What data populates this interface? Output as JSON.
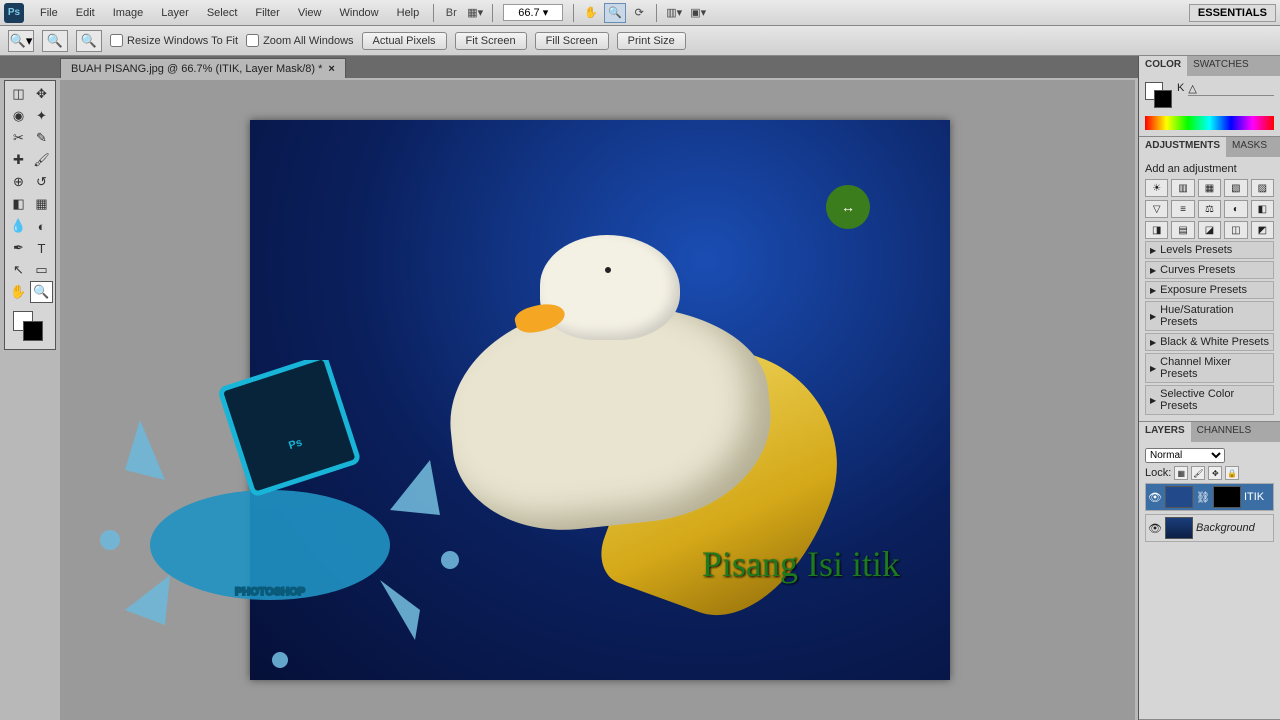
{
  "menu": {
    "items": [
      "File",
      "Edit",
      "Image",
      "Layer",
      "Select",
      "Filter",
      "View",
      "Window",
      "Help"
    ],
    "zoom": "66.7",
    "workspace": "ESSENTIALS"
  },
  "options": {
    "resize_windows": "Resize Windows To Fit",
    "zoom_all": "Zoom All Windows",
    "actual": "Actual Pixels",
    "fit": "Fit Screen",
    "fill": "Fill Screen",
    "print": "Print Size"
  },
  "tab": {
    "label": "BUAH PISANG.jpg @ 66.7% (ITIK, Layer Mask/8) *"
  },
  "canvas": {
    "text": "Pisang Isi itik"
  },
  "color": {
    "title": "COLOR",
    "swatches": "SWATCHES",
    "channel": "K"
  },
  "adjustments": {
    "title": "ADJUSTMENTS",
    "masks": "MASKS",
    "add": "Add an adjustment",
    "presets": [
      "Levels Presets",
      "Curves Presets",
      "Exposure Presets",
      "Hue/Saturation Presets",
      "Black & White Presets",
      "Channel Mixer Presets",
      "Selective Color Presets"
    ]
  },
  "layers": {
    "title": "LAYERS",
    "channels": "CHANNELS",
    "blend": "Normal",
    "lock_label": "Lock:",
    "items": [
      {
        "name": "ITIK",
        "mask": true
      },
      {
        "name": "Background",
        "mask": false
      }
    ]
  },
  "adj_icons": [
    "☀",
    "▥",
    "▦",
    "▧",
    "▨",
    "▽",
    "≡",
    "⚖",
    "◐",
    "◧",
    "◨",
    "▤",
    "◪",
    "◫",
    "◩"
  ]
}
